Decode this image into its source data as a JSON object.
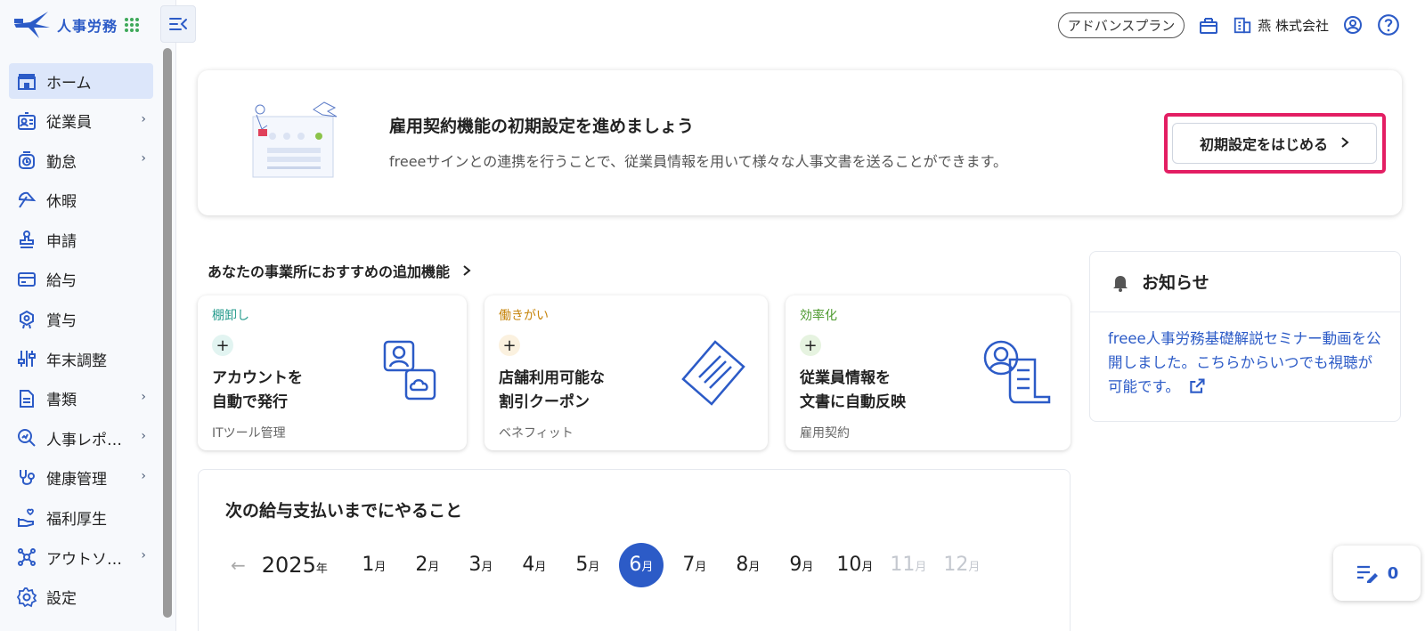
{
  "app": {
    "name": "人事労務"
  },
  "header": {
    "plan": "アドバンスプラン",
    "company": "燕 株式会社"
  },
  "sidebar": {
    "items": [
      {
        "label": "ホーム",
        "icon": "home-icon",
        "active": true,
        "has_children": false
      },
      {
        "label": "従業員",
        "icon": "id-badge-icon",
        "has_children": true
      },
      {
        "label": "勤怠",
        "icon": "clock-icon",
        "has_children": true
      },
      {
        "label": "休暇",
        "icon": "umbrella-icon",
        "has_children": false
      },
      {
        "label": "申請",
        "icon": "stamp-icon",
        "has_children": false
      },
      {
        "label": "給与",
        "icon": "card-icon",
        "has_children": false
      },
      {
        "label": "賞与",
        "icon": "medal-icon",
        "has_children": false
      },
      {
        "label": "年末調整",
        "icon": "sliders-icon",
        "has_children": false
      },
      {
        "label": "書類",
        "icon": "document-icon",
        "has_children": true
      },
      {
        "label": "人事レポ…",
        "icon": "report-search-icon",
        "has_children": true
      },
      {
        "label": "健康管理",
        "icon": "stethoscope-icon",
        "has_children": true
      },
      {
        "label": "福利厚生",
        "icon": "hand-heart-icon",
        "has_children": false
      },
      {
        "label": "アウトソ…",
        "icon": "network-icon",
        "has_children": true
      },
      {
        "label": "設定",
        "icon": "gear-icon",
        "has_children": false
      }
    ]
  },
  "banner": {
    "title": "雇用契約機能の初期設定を進めましょう",
    "description": "freeeサインとの連携を行うことで、従業員情報を用いて様々な人事文書を送ることができます。",
    "button_label": "初期設定をはじめる"
  },
  "recommendations": {
    "heading": "あなたの事業所におすすめの追加機能",
    "cards": [
      {
        "category": "棚卸し",
        "category_color": "#2a9d8f",
        "plus_bg": "#e2f4f1",
        "title_line1": "アカウントを",
        "title_line2": "自動で発行",
        "subtitle": "ITツール管理"
      },
      {
        "category": "働きがい",
        "category_color": "#c6850c",
        "plus_bg": "#fbf1df",
        "title_line1": "店舗利用可能な",
        "title_line2": "割引クーポン",
        "subtitle": "ベネフィット"
      },
      {
        "category": "効率化",
        "category_color": "#4e9a2f",
        "plus_bg": "#e6f3e0",
        "title_line1": "従業員情報を",
        "title_line2": "文書に自動反映",
        "subtitle": "雇用契約"
      }
    ]
  },
  "notice": {
    "title": "お知らせ",
    "body": "freee人事労務基礎解説セミナー動画を公開しました。こちらからいつでも視聴が可能です。"
  },
  "payroll": {
    "title": "次の給与支払いまでにやること",
    "year": "2025",
    "year_suffix": "年",
    "month_suffix": "月",
    "months": [
      {
        "num": "1",
        "state": "normal"
      },
      {
        "num": "2",
        "state": "normal"
      },
      {
        "num": "3",
        "state": "normal"
      },
      {
        "num": "4",
        "state": "normal"
      },
      {
        "num": "5",
        "state": "normal"
      },
      {
        "num": "6",
        "state": "active"
      },
      {
        "num": "7",
        "state": "normal"
      },
      {
        "num": "8",
        "state": "normal"
      },
      {
        "num": "9",
        "state": "normal"
      },
      {
        "num": "10",
        "state": "normal"
      },
      {
        "num": "11",
        "state": "disabled"
      },
      {
        "num": "12",
        "state": "disabled"
      }
    ]
  },
  "tasks": {
    "count": "0"
  },
  "colors": {
    "accent": "#2c5bc7",
    "highlight": "#e31e63",
    "sidebar_bg": "#f7f9fc"
  }
}
